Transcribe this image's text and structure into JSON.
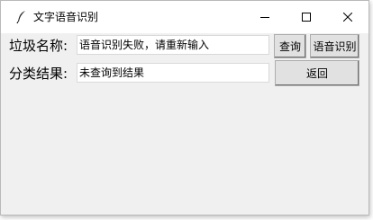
{
  "window": {
    "title": "文字语音识别",
    "controls": {
      "minimize": "—",
      "maximize": "☐",
      "close": "✕"
    }
  },
  "form": {
    "name_label": "垃圾名称:",
    "name_value": "语音识别失败，请重新输入",
    "result_label": "分类结果:",
    "result_value": "未查询到结果"
  },
  "buttons": {
    "query": "查询",
    "voice": "语音识别",
    "back": "返回"
  }
}
